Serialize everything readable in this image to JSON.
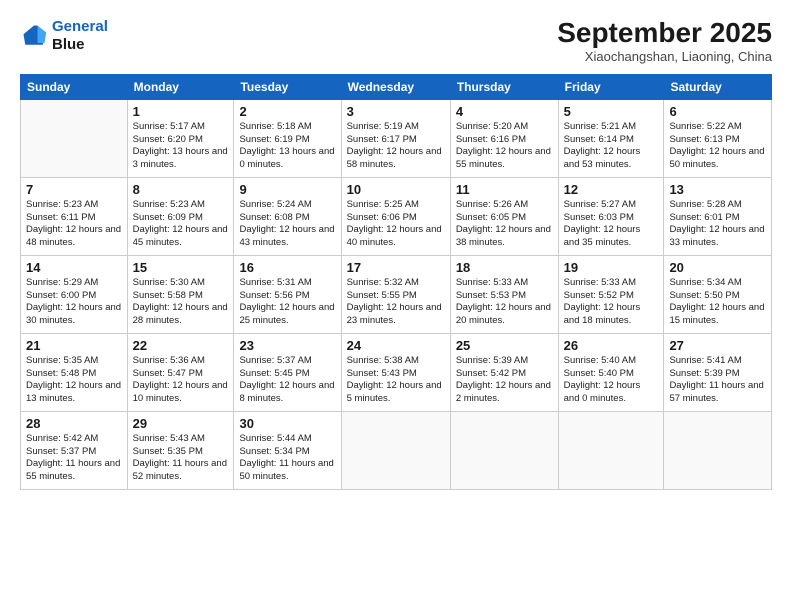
{
  "header": {
    "logo_line1": "General",
    "logo_line2": "Blue",
    "month": "September 2025",
    "location": "Xiaochangshan, Liaoning, China"
  },
  "days_of_week": [
    "Sunday",
    "Monday",
    "Tuesday",
    "Wednesday",
    "Thursday",
    "Friday",
    "Saturday"
  ],
  "weeks": [
    [
      {
        "day": "",
        "sunrise": "",
        "sunset": "",
        "daylight": ""
      },
      {
        "day": "1",
        "sunrise": "Sunrise: 5:17 AM",
        "sunset": "Sunset: 6:20 PM",
        "daylight": "Daylight: 13 hours and 3 minutes."
      },
      {
        "day": "2",
        "sunrise": "Sunrise: 5:18 AM",
        "sunset": "Sunset: 6:19 PM",
        "daylight": "Daylight: 13 hours and 0 minutes."
      },
      {
        "day": "3",
        "sunrise": "Sunrise: 5:19 AM",
        "sunset": "Sunset: 6:17 PM",
        "daylight": "Daylight: 12 hours and 58 minutes."
      },
      {
        "day": "4",
        "sunrise": "Sunrise: 5:20 AM",
        "sunset": "Sunset: 6:16 PM",
        "daylight": "Daylight: 12 hours and 55 minutes."
      },
      {
        "day": "5",
        "sunrise": "Sunrise: 5:21 AM",
        "sunset": "Sunset: 6:14 PM",
        "daylight": "Daylight: 12 hours and 53 minutes."
      },
      {
        "day": "6",
        "sunrise": "Sunrise: 5:22 AM",
        "sunset": "Sunset: 6:13 PM",
        "daylight": "Daylight: 12 hours and 50 minutes."
      }
    ],
    [
      {
        "day": "7",
        "sunrise": "Sunrise: 5:23 AM",
        "sunset": "Sunset: 6:11 PM",
        "daylight": "Daylight: 12 hours and 48 minutes."
      },
      {
        "day": "8",
        "sunrise": "Sunrise: 5:23 AM",
        "sunset": "Sunset: 6:09 PM",
        "daylight": "Daylight: 12 hours and 45 minutes."
      },
      {
        "day": "9",
        "sunrise": "Sunrise: 5:24 AM",
        "sunset": "Sunset: 6:08 PM",
        "daylight": "Daylight: 12 hours and 43 minutes."
      },
      {
        "day": "10",
        "sunrise": "Sunrise: 5:25 AM",
        "sunset": "Sunset: 6:06 PM",
        "daylight": "Daylight: 12 hours and 40 minutes."
      },
      {
        "day": "11",
        "sunrise": "Sunrise: 5:26 AM",
        "sunset": "Sunset: 6:05 PM",
        "daylight": "Daylight: 12 hours and 38 minutes."
      },
      {
        "day": "12",
        "sunrise": "Sunrise: 5:27 AM",
        "sunset": "Sunset: 6:03 PM",
        "daylight": "Daylight: 12 hours and 35 minutes."
      },
      {
        "day": "13",
        "sunrise": "Sunrise: 5:28 AM",
        "sunset": "Sunset: 6:01 PM",
        "daylight": "Daylight: 12 hours and 33 minutes."
      }
    ],
    [
      {
        "day": "14",
        "sunrise": "Sunrise: 5:29 AM",
        "sunset": "Sunset: 6:00 PM",
        "daylight": "Daylight: 12 hours and 30 minutes."
      },
      {
        "day": "15",
        "sunrise": "Sunrise: 5:30 AM",
        "sunset": "Sunset: 5:58 PM",
        "daylight": "Daylight: 12 hours and 28 minutes."
      },
      {
        "day": "16",
        "sunrise": "Sunrise: 5:31 AM",
        "sunset": "Sunset: 5:56 PM",
        "daylight": "Daylight: 12 hours and 25 minutes."
      },
      {
        "day": "17",
        "sunrise": "Sunrise: 5:32 AM",
        "sunset": "Sunset: 5:55 PM",
        "daylight": "Daylight: 12 hours and 23 minutes."
      },
      {
        "day": "18",
        "sunrise": "Sunrise: 5:33 AM",
        "sunset": "Sunset: 5:53 PM",
        "daylight": "Daylight: 12 hours and 20 minutes."
      },
      {
        "day": "19",
        "sunrise": "Sunrise: 5:33 AM",
        "sunset": "Sunset: 5:52 PM",
        "daylight": "Daylight: 12 hours and 18 minutes."
      },
      {
        "day": "20",
        "sunrise": "Sunrise: 5:34 AM",
        "sunset": "Sunset: 5:50 PM",
        "daylight": "Daylight: 12 hours and 15 minutes."
      }
    ],
    [
      {
        "day": "21",
        "sunrise": "Sunrise: 5:35 AM",
        "sunset": "Sunset: 5:48 PM",
        "daylight": "Daylight: 12 hours and 13 minutes."
      },
      {
        "day": "22",
        "sunrise": "Sunrise: 5:36 AM",
        "sunset": "Sunset: 5:47 PM",
        "daylight": "Daylight: 12 hours and 10 minutes."
      },
      {
        "day": "23",
        "sunrise": "Sunrise: 5:37 AM",
        "sunset": "Sunset: 5:45 PM",
        "daylight": "Daylight: 12 hours and 8 minutes."
      },
      {
        "day": "24",
        "sunrise": "Sunrise: 5:38 AM",
        "sunset": "Sunset: 5:43 PM",
        "daylight": "Daylight: 12 hours and 5 minutes."
      },
      {
        "day": "25",
        "sunrise": "Sunrise: 5:39 AM",
        "sunset": "Sunset: 5:42 PM",
        "daylight": "Daylight: 12 hours and 2 minutes."
      },
      {
        "day": "26",
        "sunrise": "Sunrise: 5:40 AM",
        "sunset": "Sunset: 5:40 PM",
        "daylight": "Daylight: 12 hours and 0 minutes."
      },
      {
        "day": "27",
        "sunrise": "Sunrise: 5:41 AM",
        "sunset": "Sunset: 5:39 PM",
        "daylight": "Daylight: 11 hours and 57 minutes."
      }
    ],
    [
      {
        "day": "28",
        "sunrise": "Sunrise: 5:42 AM",
        "sunset": "Sunset: 5:37 PM",
        "daylight": "Daylight: 11 hours and 55 minutes."
      },
      {
        "day": "29",
        "sunrise": "Sunrise: 5:43 AM",
        "sunset": "Sunset: 5:35 PM",
        "daylight": "Daylight: 11 hours and 52 minutes."
      },
      {
        "day": "30",
        "sunrise": "Sunrise: 5:44 AM",
        "sunset": "Sunset: 5:34 PM",
        "daylight": "Daylight: 11 hours and 50 minutes."
      },
      {
        "day": "",
        "sunrise": "",
        "sunset": "",
        "daylight": ""
      },
      {
        "day": "",
        "sunrise": "",
        "sunset": "",
        "daylight": ""
      },
      {
        "day": "",
        "sunrise": "",
        "sunset": "",
        "daylight": ""
      },
      {
        "day": "",
        "sunrise": "",
        "sunset": "",
        "daylight": ""
      }
    ]
  ]
}
